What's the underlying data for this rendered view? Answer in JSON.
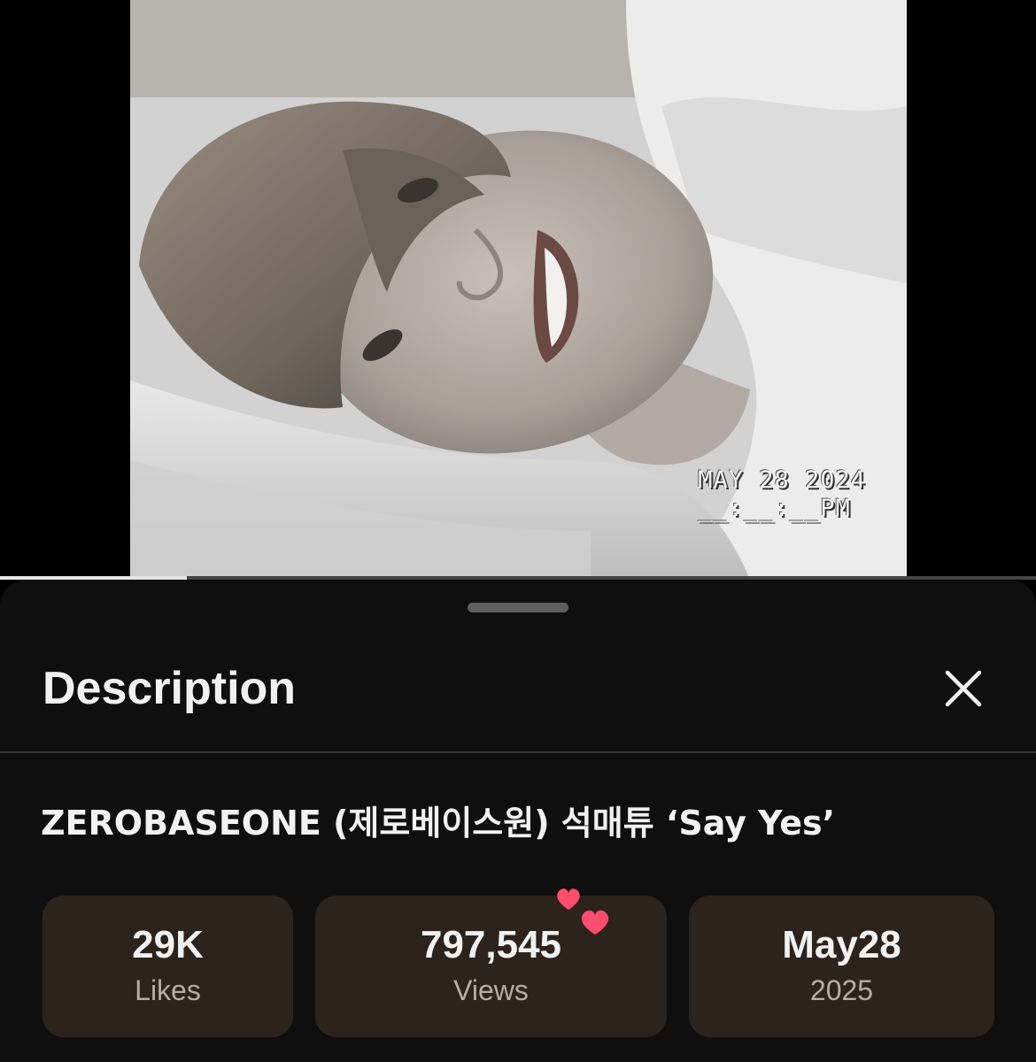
{
  "player": {
    "overlay_date": "MAY 28 2024",
    "overlay_time": "__:__:__PM",
    "progress_fraction": 0.18
  },
  "sheet": {
    "title": "Description",
    "close_icon": "close-icon"
  },
  "video": {
    "title": "ZEROBASEONE (제로베이스원) 석매튜 ‘Say Yes’"
  },
  "stats": [
    {
      "value": "29K",
      "label": "Likes"
    },
    {
      "value": "797,545",
      "label": "Views"
    },
    {
      "value": "May28",
      "label": "2025"
    }
  ],
  "decoration": {
    "sticker_icon": "two-hearts-icon",
    "heart_color": "#ff4d6d"
  },
  "colors": {
    "sheet_bg": "#0f0f0f",
    "stat_bg": "#2c231c"
  }
}
